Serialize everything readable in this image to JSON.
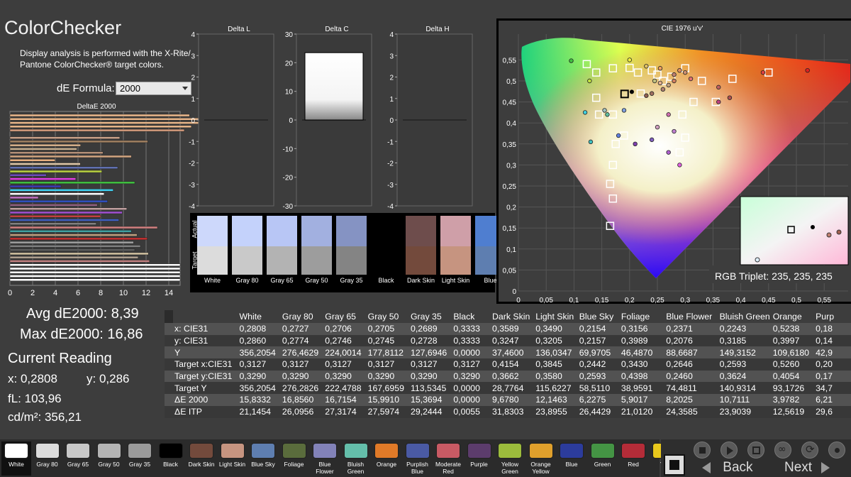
{
  "app": {
    "title": "ColorChecker",
    "description": "Display analysis is performed with the X-Rite/ Pantone ColorChecker® target colors.",
    "formula_label": "dE Formula:",
    "formula_value": "2000"
  },
  "deltae_chart": {
    "title": "DeltaE 2000",
    "x_ticks": [
      "0",
      "2",
      "4",
      "6",
      "8",
      "10",
      "12",
      "14"
    ]
  },
  "mini_charts": [
    {
      "title": "Delta L",
      "ticks": [
        "4",
        "3",
        "2",
        "1",
        "0",
        "-1",
        "-2",
        "-3",
        "-4"
      ]
    },
    {
      "title": "Delta C",
      "ticks": [
        "30",
        "20",
        "10",
        "0",
        "-10",
        "-20",
        "-30"
      ]
    },
    {
      "title": "Delta H",
      "ticks": [
        "4",
        "3",
        "2",
        "1",
        "0",
        "-1",
        "-2",
        "-3",
        "-4"
      ]
    }
  ],
  "swatch_strip": {
    "actual_label": "Actual",
    "target_label": "Target",
    "items": [
      {
        "label": "White",
        "actual": "#cdd8fb",
        "target": "#dcdcdc"
      },
      {
        "label": "Gray 80",
        "actual": "#c4d2fb",
        "target": "#c9c9c9"
      },
      {
        "label": "Gray 65",
        "actual": "#b8c6f5",
        "target": "#b3b3b3"
      },
      {
        "label": "Gray 50",
        "actual": "#a2b0e0",
        "target": "#9d9d9d"
      },
      {
        "label": "Gray 35",
        "actual": "#8593c3",
        "target": "#848484"
      },
      {
        "label": "Black",
        "actual": "#000000",
        "target": "#000000"
      },
      {
        "label": "Dark Skin",
        "actual": "#6e4d4c",
        "target": "#734a3c"
      },
      {
        "label": "Light Skin",
        "actual": "#cf9fa8",
        "target": "#c69480"
      },
      {
        "label": "Blue",
        "actual": "#4f7ed0",
        "target": "#5e7eb0"
      }
    ]
  },
  "cie": {
    "title": "CIE 1976 u'v'",
    "y_ticks": [
      "0,55",
      "0,5",
      "0,45",
      "0,4",
      "0,35",
      "0,3",
      "0,25",
      "0,2",
      "0,15",
      "0,1",
      "0,05",
      "0"
    ],
    "x_ticks": [
      "0",
      "0,05",
      "0,1",
      "0,15",
      "0,2",
      "0,25",
      "0,3",
      "0,35",
      "0,4",
      "0,45",
      "0,5",
      "0,55"
    ],
    "rgb_triplet": "RGB Triplet: 235, 235, 235"
  },
  "stats": {
    "avg": "Avg dE2000: 8,39",
    "max": "Max dE2000: 16,86",
    "current_label": "Current Reading",
    "x": "x: 0,2808",
    "y": "y: 0,286",
    "fl": "fL: 103,96",
    "cdm2": "cd/m²: 356,21"
  },
  "table": {
    "headers": [
      "",
      "White",
      "Gray 80",
      "Gray 65",
      "Gray 50",
      "Gray 35",
      "Black",
      "Dark Skin",
      "Light Skin",
      "Blue Sky",
      "Foliage",
      "Blue Flower",
      "Bluish Green",
      "Orange",
      "Purp"
    ],
    "rows": [
      {
        "label": "x: CIE31",
        "values": [
          "0,2808",
          "0,2727",
          "0,2706",
          "0,2705",
          "0,2689",
          "0,3333",
          "0,3589",
          "0,3490",
          "0,2154",
          "0,3156",
          "0,2371",
          "0,2243",
          "0,5238",
          "0,18"
        ]
      },
      {
        "label": "y: CIE31",
        "values": [
          "0,2860",
          "0,2774",
          "0,2746",
          "0,2745",
          "0,2728",
          "0,3333",
          "0,3247",
          "0,3205",
          "0,2157",
          "0,3989",
          "0,2076",
          "0,3185",
          "0,3997",
          "0,14"
        ]
      },
      {
        "label": "Y",
        "values": [
          "356,2054",
          "276,4629",
          "224,0014",
          "177,8112",
          "127,6946",
          "0,0000",
          "37,4600",
          "136,0347",
          "69,9705",
          "46,4870",
          "88,6687",
          "149,3152",
          "109,6180",
          "42,9"
        ]
      },
      {
        "label": "Target x:CIE31",
        "values": [
          "0,3127",
          "0,3127",
          "0,3127",
          "0,3127",
          "0,3127",
          "0,3127",
          "0,4154",
          "0,3845",
          "0,2442",
          "0,3430",
          "0,2646",
          "0,2593",
          "0,5260",
          "0,20"
        ]
      },
      {
        "label": "Target y:CIE31",
        "values": [
          "0,3290",
          "0,3290",
          "0,3290",
          "0,3290",
          "0,3290",
          "0,3290",
          "0,3662",
          "0,3580",
          "0,2593",
          "0,4398",
          "0,2460",
          "0,3624",
          "0,4054",
          "0,17"
        ]
      },
      {
        "label": "Target Y",
        "values": [
          "356,2054",
          "276,2826",
          "222,4788",
          "167,6959",
          "113,5345",
          "0,0000",
          "28,7764",
          "115,6227",
          "58,5110",
          "38,9591",
          "74,4811",
          "140,9314",
          "93,1726",
          "34,7"
        ]
      },
      {
        "label": "ΔE 2000",
        "values": [
          "15,8332",
          "16,8560",
          "16,7154",
          "15,9910",
          "15,3694",
          "0,0000",
          "9,6780",
          "12,1463",
          "6,2275",
          "5,9017",
          "8,2025",
          "10,7111",
          "3,9782",
          "6,21"
        ]
      },
      {
        "label": "ΔE ITP",
        "values": [
          "21,1454",
          "26,0956",
          "27,3174",
          "27,5974",
          "29,2444",
          "0,0055",
          "31,8303",
          "23,8955",
          "26,4429",
          "21,0120",
          "24,3585",
          "23,9039",
          "12,5619",
          "29,6"
        ]
      }
    ]
  },
  "patches": [
    {
      "label": "White",
      "color": "#ffffff"
    },
    {
      "label": "Gray 80",
      "color": "#dcdcdc"
    },
    {
      "label": "Gray 65",
      "color": "#c8c8c8"
    },
    {
      "label": "Gray 50",
      "color": "#b4b4b4"
    },
    {
      "label": "Gray 35",
      "color": "#9a9a9a"
    },
    {
      "label": "Black",
      "color": "#000000"
    },
    {
      "label": "Dark Skin",
      "color": "#734a3c"
    },
    {
      "label": "Light Skin",
      "color": "#c69480"
    },
    {
      "label": "Blue Sky",
      "color": "#5e7eb0"
    },
    {
      "label": "Foliage",
      "color": "#5a6c3c"
    },
    {
      "label": "Blue Flower",
      "color": "#8282b8"
    },
    {
      "label": "Bluish Green",
      "color": "#64beaa"
    },
    {
      "label": "Orange",
      "color": "#e07a28"
    },
    {
      "label": "Purplish Blue",
      "color": "#4a5aa4"
    },
    {
      "label": "Moderate Red",
      "color": "#c85a64"
    },
    {
      "label": "Purple",
      "color": "#5c3c6c"
    },
    {
      "label": "Yellow Green",
      "color": "#9cbc3c"
    },
    {
      "label": "Orange Yellow",
      "color": "#e0a02c"
    },
    {
      "label": "Blue",
      "color": "#2c3c9c"
    },
    {
      "label": "Green",
      "color": "#449444"
    },
    {
      "label": "Red",
      "color": "#b42c38"
    },
    {
      "label": "Yel",
      "color": "#e8c81c"
    }
  ],
  "controls": {
    "back_label": "Back",
    "next_label": "Next"
  },
  "chart_data": [
    {
      "type": "bar",
      "title": "DeltaE 2000",
      "xlim": [
        0,
        15
      ],
      "values": [
        15.83,
        16.86,
        16.72,
        15.99,
        15.37,
        0.0,
        9.68,
        12.15,
        6.23,
        5.9,
        8.2,
        10.71,
        3.98,
        6.21,
        9.5,
        8.1,
        3.2,
        5.8,
        11.0,
        4.5,
        9.1,
        8.3,
        2.5,
        8.6,
        7.7,
        10.3,
        9.9,
        8.0,
        9.6,
        7.6,
        13.0,
        10.7,
        11.2,
        12.1,
        10.9,
        11.5,
        11.0,
        12.2,
        11.3,
        12.3,
        15.0,
        15.0,
        15.0,
        15.0,
        15.0
      ],
      "colors": [
        "#e8b68a",
        "#e8b68a",
        "#e8b68a",
        "#e8b68a",
        "#d39a7c",
        "#e0c0a0",
        "#c8a088",
        "#a08060",
        "#d6b08a",
        "#c8b090",
        "#b49078",
        "#d0a480",
        "#e8b080",
        "#e0c8a8",
        "#6070b0",
        "#b8d040",
        "#6c4cbc",
        "#e040e0",
        "#40c040",
        "#3c3cb4",
        "#40d0f0",
        "#ffffff",
        "#c070c0",
        "#3050c0",
        "#906080",
        "#c0a0a0",
        "#a050d0",
        "#c04040",
        "#4060c0",
        "#808080",
        "#d08080",
        "#40a0a0",
        "#c0a080",
        "#c03030",
        "#a0a0a0",
        "#808080",
        "#606060",
        "#d0c0a0",
        "#b0a090",
        "#c08080",
        "#ffffff",
        "#ffffff",
        "#ffffff",
        "#ffffff",
        "#ffffff"
      ]
    },
    {
      "type": "bar",
      "title": "Delta C",
      "categories": [
        "White"
      ],
      "values": [
        23.5
      ],
      "ylim": [
        -30,
        30
      ]
    }
  ]
}
